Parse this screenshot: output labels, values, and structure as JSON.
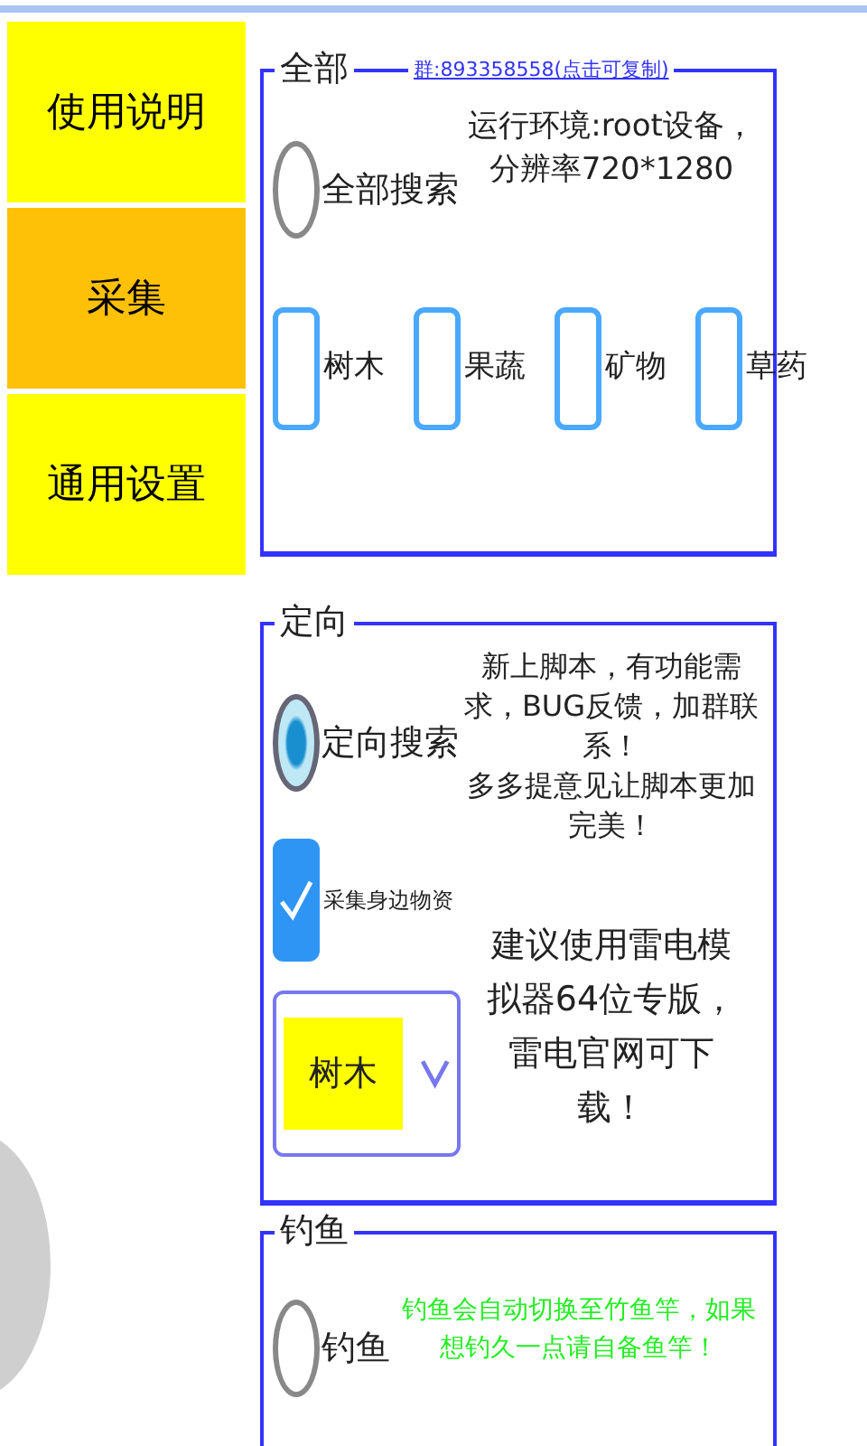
{
  "sidebar": {
    "items": [
      {
        "label": "使用说明",
        "selected": false
      },
      {
        "label": "采集",
        "selected": true
      },
      {
        "label": "通用设置",
        "selected": false
      }
    ]
  },
  "sections": [
    {
      "title": "全部",
      "link": "群:893358558(点击可复制)",
      "radio": {
        "label": "全部搜索",
        "selected": false
      },
      "notes": [
        {
          "text": "运行环境:root设备，分辨率720*1280",
          "color": "#222222"
        }
      ],
      "checkboxes": [
        {
          "label": "树木",
          "checked": false
        },
        {
          "label": "果蔬",
          "checked": false
        },
        {
          "label": "矿物",
          "checked": false
        },
        {
          "label": "草药",
          "checked": false
        }
      ]
    },
    {
      "title": "定向",
      "radio": {
        "label": "定向搜索",
        "selected": true
      },
      "option": {
        "label": "采集身边物资",
        "checked": true
      },
      "dropdown": {
        "value": "树木"
      },
      "notes": [
        {
          "text": "新上脚本，有功能需求，BUG反馈，加群联系！",
          "color": "#222222"
        },
        {
          "text": "多多提意见让脚本更加完美！",
          "color": "#222222"
        },
        {
          "text": "建议使用雷电模拟器64位专版，雷电官网可下载！",
          "color": "#222222"
        }
      ]
    },
    {
      "title": "钓鱼",
      "radio": {
        "label": "钓鱼",
        "selected": false
      },
      "notes": [
        {
          "text": "钓鱼会自动切换至竹鱼竿，如果想钓久一点请自备鱼竿！",
          "color": "#22ee22"
        }
      ]
    }
  ]
}
